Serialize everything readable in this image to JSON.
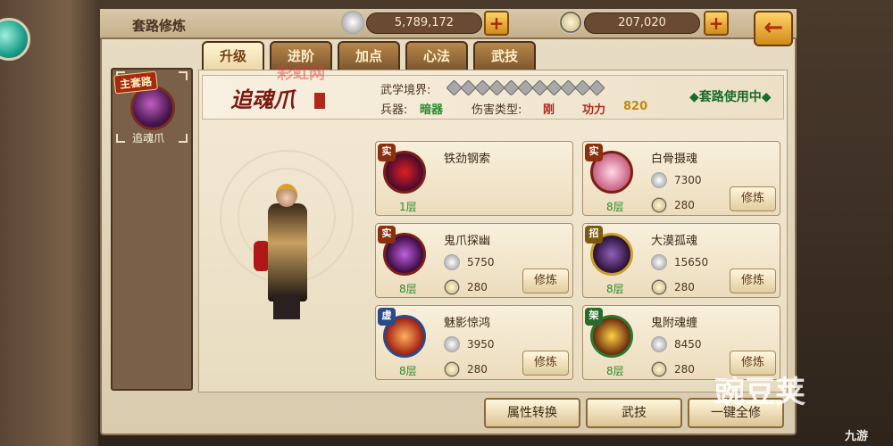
{
  "window": {
    "title": "套路修炼"
  },
  "resources": {
    "silver_value": "5,789,172",
    "gold_value": "207,020",
    "plus_label": "+"
  },
  "back_icon": "arrow-left-icon",
  "tabs": [
    {
      "label": "升级",
      "active": true
    },
    {
      "label": "进阶",
      "active": false
    },
    {
      "label": "加点",
      "active": false
    },
    {
      "label": "心法",
      "active": false
    },
    {
      "label": "武技",
      "active": false
    }
  ],
  "left_panel": {
    "badge": "主套路",
    "skill_name": "追魂爪"
  },
  "info": {
    "calligraphy": "追魂爪",
    "realm_label": "武学境界:",
    "weapon_label": "兵器:",
    "weapon_value": "暗器",
    "damage_type_label": "伤害类型:",
    "damage_type_value": "刚",
    "power_label": "功力",
    "power_value": "820",
    "status": "◆套路使用中◆"
  },
  "skills": [
    {
      "name": "铁劲钢索",
      "tag": "实",
      "level": "1层",
      "silver": "",
      "gold": "",
      "button": ""
    },
    {
      "name": "白骨摄魂",
      "tag": "实",
      "level": "8层",
      "silver": "7300",
      "gold": "280",
      "button": "修炼"
    },
    {
      "name": "鬼爪探幽",
      "tag": "实",
      "level": "8层",
      "silver": "5750",
      "gold": "280",
      "button": "修炼"
    },
    {
      "name": "大漠孤魂",
      "tag": "招",
      "level": "8层",
      "silver": "15650",
      "gold": "280",
      "button": "修炼"
    },
    {
      "name": "魅影惊鸿",
      "tag": "虚",
      "level": "8层",
      "silver": "3950",
      "gold": "280",
      "button": "修炼"
    },
    {
      "name": "鬼附魂缠",
      "tag": "架",
      "level": "8层",
      "silver": "8450",
      "gold": "280",
      "button": "修炼"
    }
  ],
  "bottom_buttons": {
    "convert": "属性转换",
    "martial": "武技",
    "upgrade_all": "一键全修"
  },
  "watermarks": {
    "center": "彩虹网",
    "brand": "豌豆荚",
    "corner": "九游"
  },
  "colors": {
    "accent_gold": "#d08a1a",
    "status_green": "#1a6a2a",
    "level_green": "#2a8a2a",
    "brand_red": "#a62a12"
  }
}
